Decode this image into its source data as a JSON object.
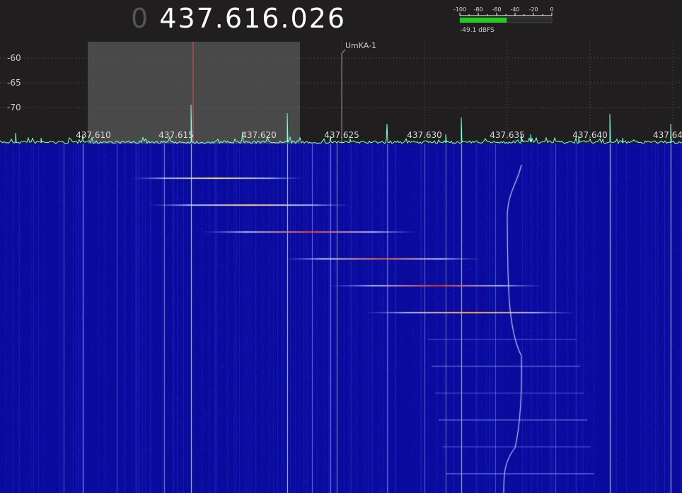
{
  "frequency": {
    "dim_prefix": "0",
    "value": "437.616.026"
  },
  "smeter": {
    "scale_ticks": [
      "-100",
      "-80",
      "-60",
      "-40",
      "-20",
      "0"
    ],
    "reading": "-49.1 dBFS",
    "level_fraction": 0.51,
    "bar_color": "#22cc22"
  },
  "spectrum": {
    "y_axis_labels": [
      "-60",
      "-65",
      "-70"
    ],
    "x_axis_labels": [
      "437.610",
      "437.615",
      "437.620",
      "437.625",
      "437.630",
      "437.635",
      "437.640",
      "437.64"
    ],
    "trace_color": "#7fffe8",
    "selection_color": "#4a4949",
    "center_marker_color": "#e05050",
    "marker_label": "UmKA-1"
  },
  "waterfall": {
    "background_color": "#0a0a9c"
  }
}
